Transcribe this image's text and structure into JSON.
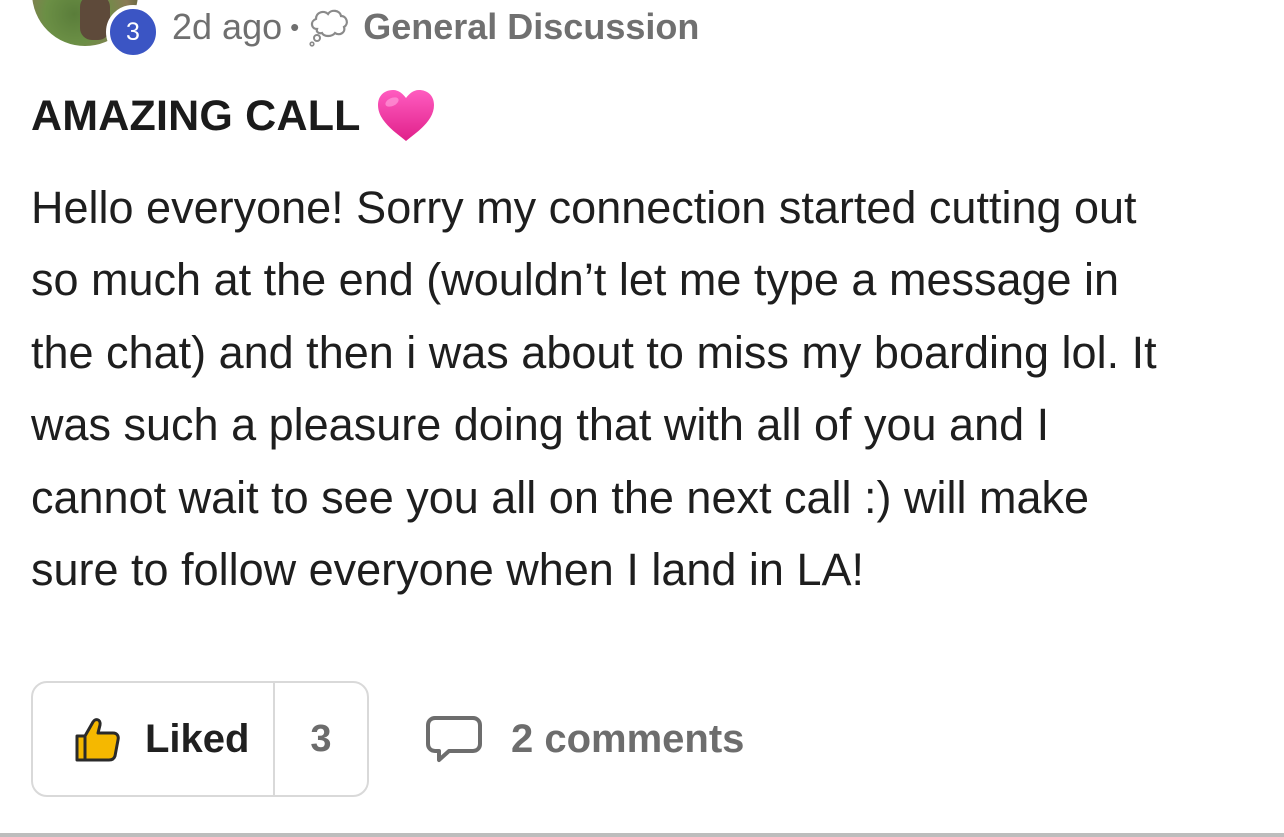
{
  "post": {
    "author_level": "3",
    "time_ago": "2d ago",
    "separator": "•",
    "category_icon": "thought-bubble-icon",
    "category": "General Discussion",
    "title": "AMAZING CALL",
    "title_emoji": "pink-heart-icon",
    "body_lines": [
      "Hello everyone! Sorry my connection started cutting out",
      "so much at the end (wouldn’t let me type a message in",
      "the chat) and then i was about to miss my boarding lol. It",
      "was such a pleasure doing that with all of you and I",
      "cannot wait to see you all on the next call :) will make",
      "sure to follow everyone when I land in LA!"
    ]
  },
  "actions": {
    "like_icon": "thumbs-up-icon",
    "like_label": "Liked",
    "like_count": "3",
    "comment_icon": "comment-bubble-icon",
    "comments_label": "2 comments"
  },
  "colors": {
    "level_badge": "#3b55c4",
    "like_icon_fill": "#f5b800",
    "heart": "#f0309c"
  }
}
